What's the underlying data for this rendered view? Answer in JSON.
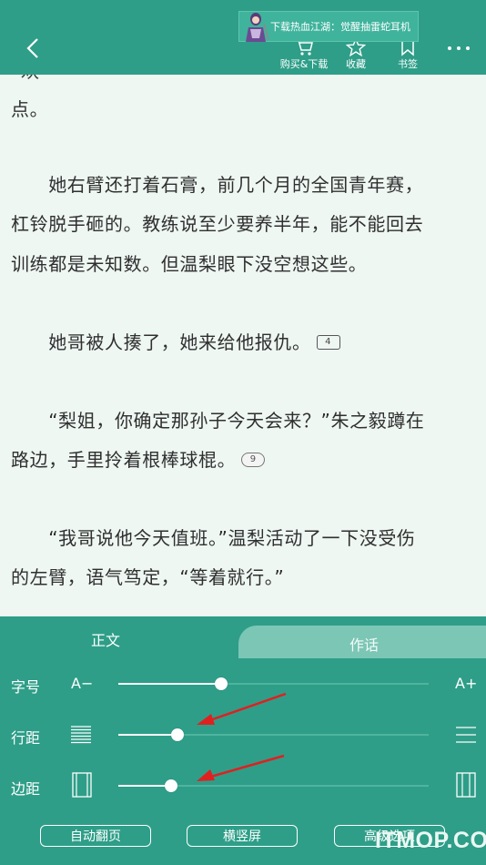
{
  "topbar": {
    "actions": [
      {
        "label": "购买&下载",
        "icon": "cart-icon"
      },
      {
        "label": "收藏",
        "icon": "star-icon"
      },
      {
        "label": "书签",
        "icon": "bookmark-icon"
      }
    ],
    "ad": {
      "text": "下载热血江湖：觉醒抽雷蛇耳机"
    }
  },
  "content": {
    "cut_line": "“欢~~~~~~~~~~~~~~~~~~~~~~”",
    "lines": [
      "点。",
      "　　她右臂还打着石膏，前几个月的全国青年赛，",
      "杠铃脱手砸的。教练说至少要养半年，能不能回去",
      "训练都是未知数。但温梨眼下没空想这些。",
      "　　她哥被人揍了，她来给他报仇。",
      "　　“梨姐，你确定那孙子今天会来？”朱之毅蹲在",
      "路边，手里拎着根棒球棍。",
      "　　“我哥说他今天值班。”温梨活动了一下没受伤",
      "的左臂，语气笃定，“等着就行。”"
    ],
    "note_badges": {
      "first": "4",
      "second": "9"
    }
  },
  "settings": {
    "tabs": {
      "main": "正文",
      "author": "作话"
    },
    "font_size": {
      "label": "字号",
      "decrease": "A−",
      "increase": "A+",
      "level": 0.33
    },
    "line_spacing": {
      "label": "行距",
      "level": 0.19
    },
    "margin": {
      "label": "边距",
      "level": 0.17
    },
    "buttons": {
      "auto_page": "自动翻页",
      "orientation": "横竖屏",
      "advanced": "高级选项"
    }
  },
  "watermark": "ITMOP.COM",
  "colors": {
    "accent": "#2e9e88",
    "tab_inactive": "#7cc6b6",
    "page_bg": "#eef7f2",
    "arrow": "#e02020"
  }
}
